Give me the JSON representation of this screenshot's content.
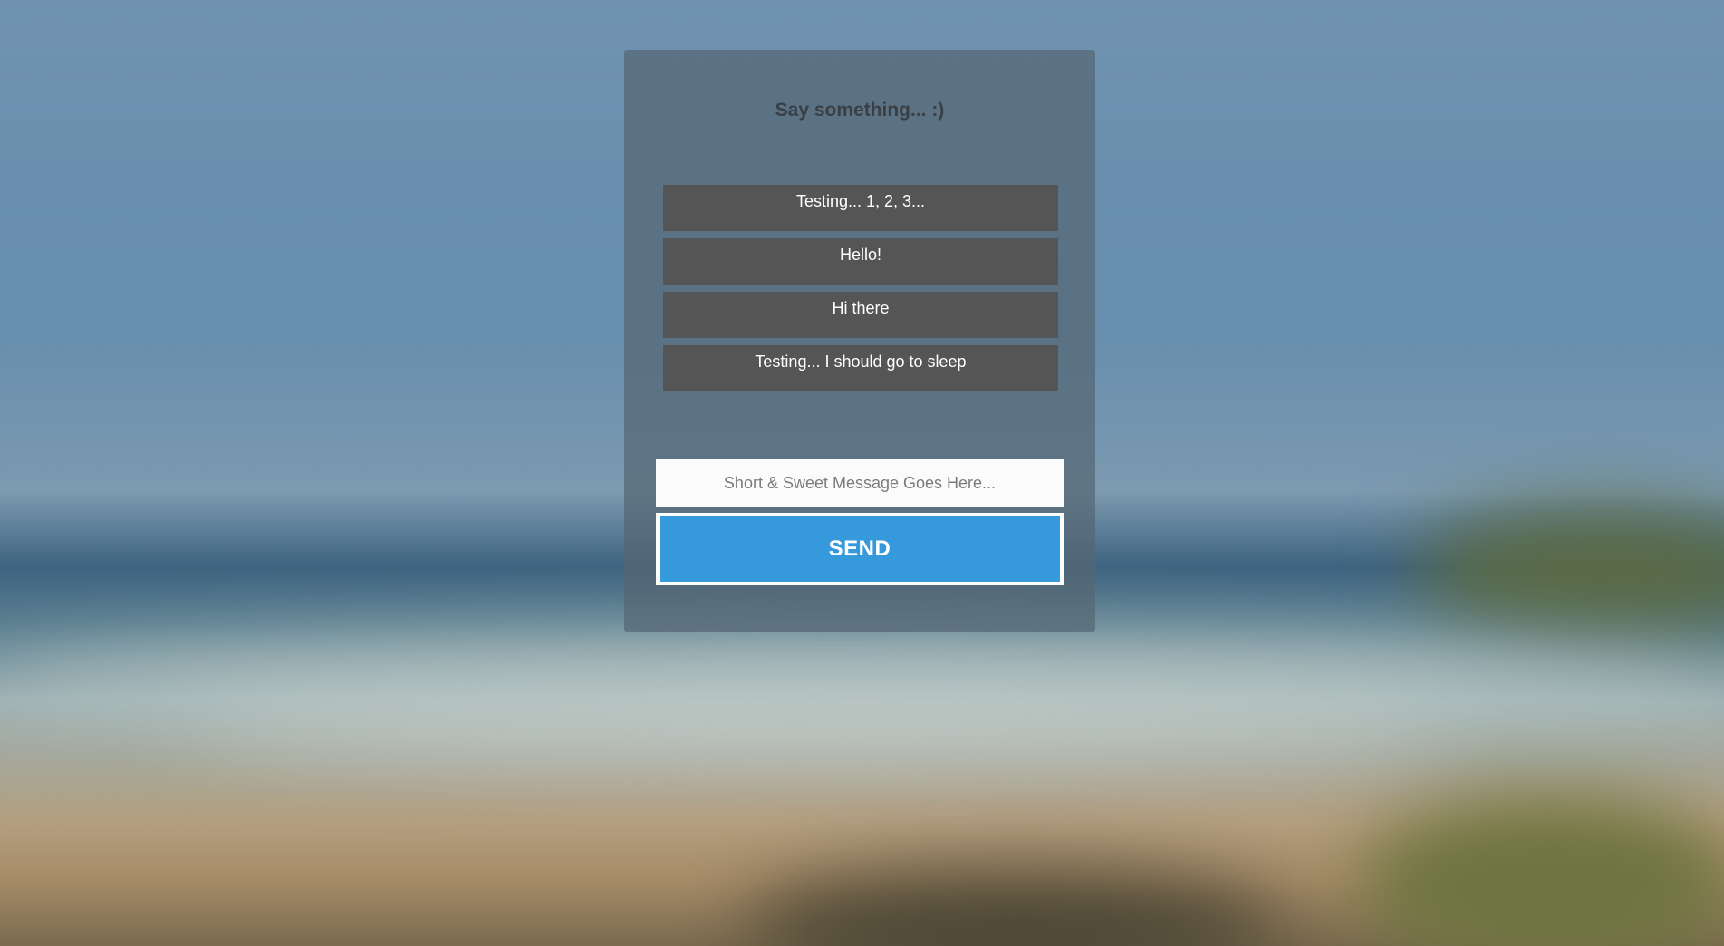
{
  "page": {
    "heading": "Say something... :)"
  },
  "messages": [
    {
      "text": "Testing... 1, 2, 3..."
    },
    {
      "text": "Hello!"
    },
    {
      "text": "Hi there"
    },
    {
      "text": "Testing... I should go to sleep"
    }
  ],
  "composer": {
    "value": "",
    "placeholder": "Short & Sweet Message Goes Here...",
    "send_label": "SEND"
  },
  "colors": {
    "send_button": "#3699dc",
    "message_bubble": "#555555",
    "panel": "#556673"
  }
}
